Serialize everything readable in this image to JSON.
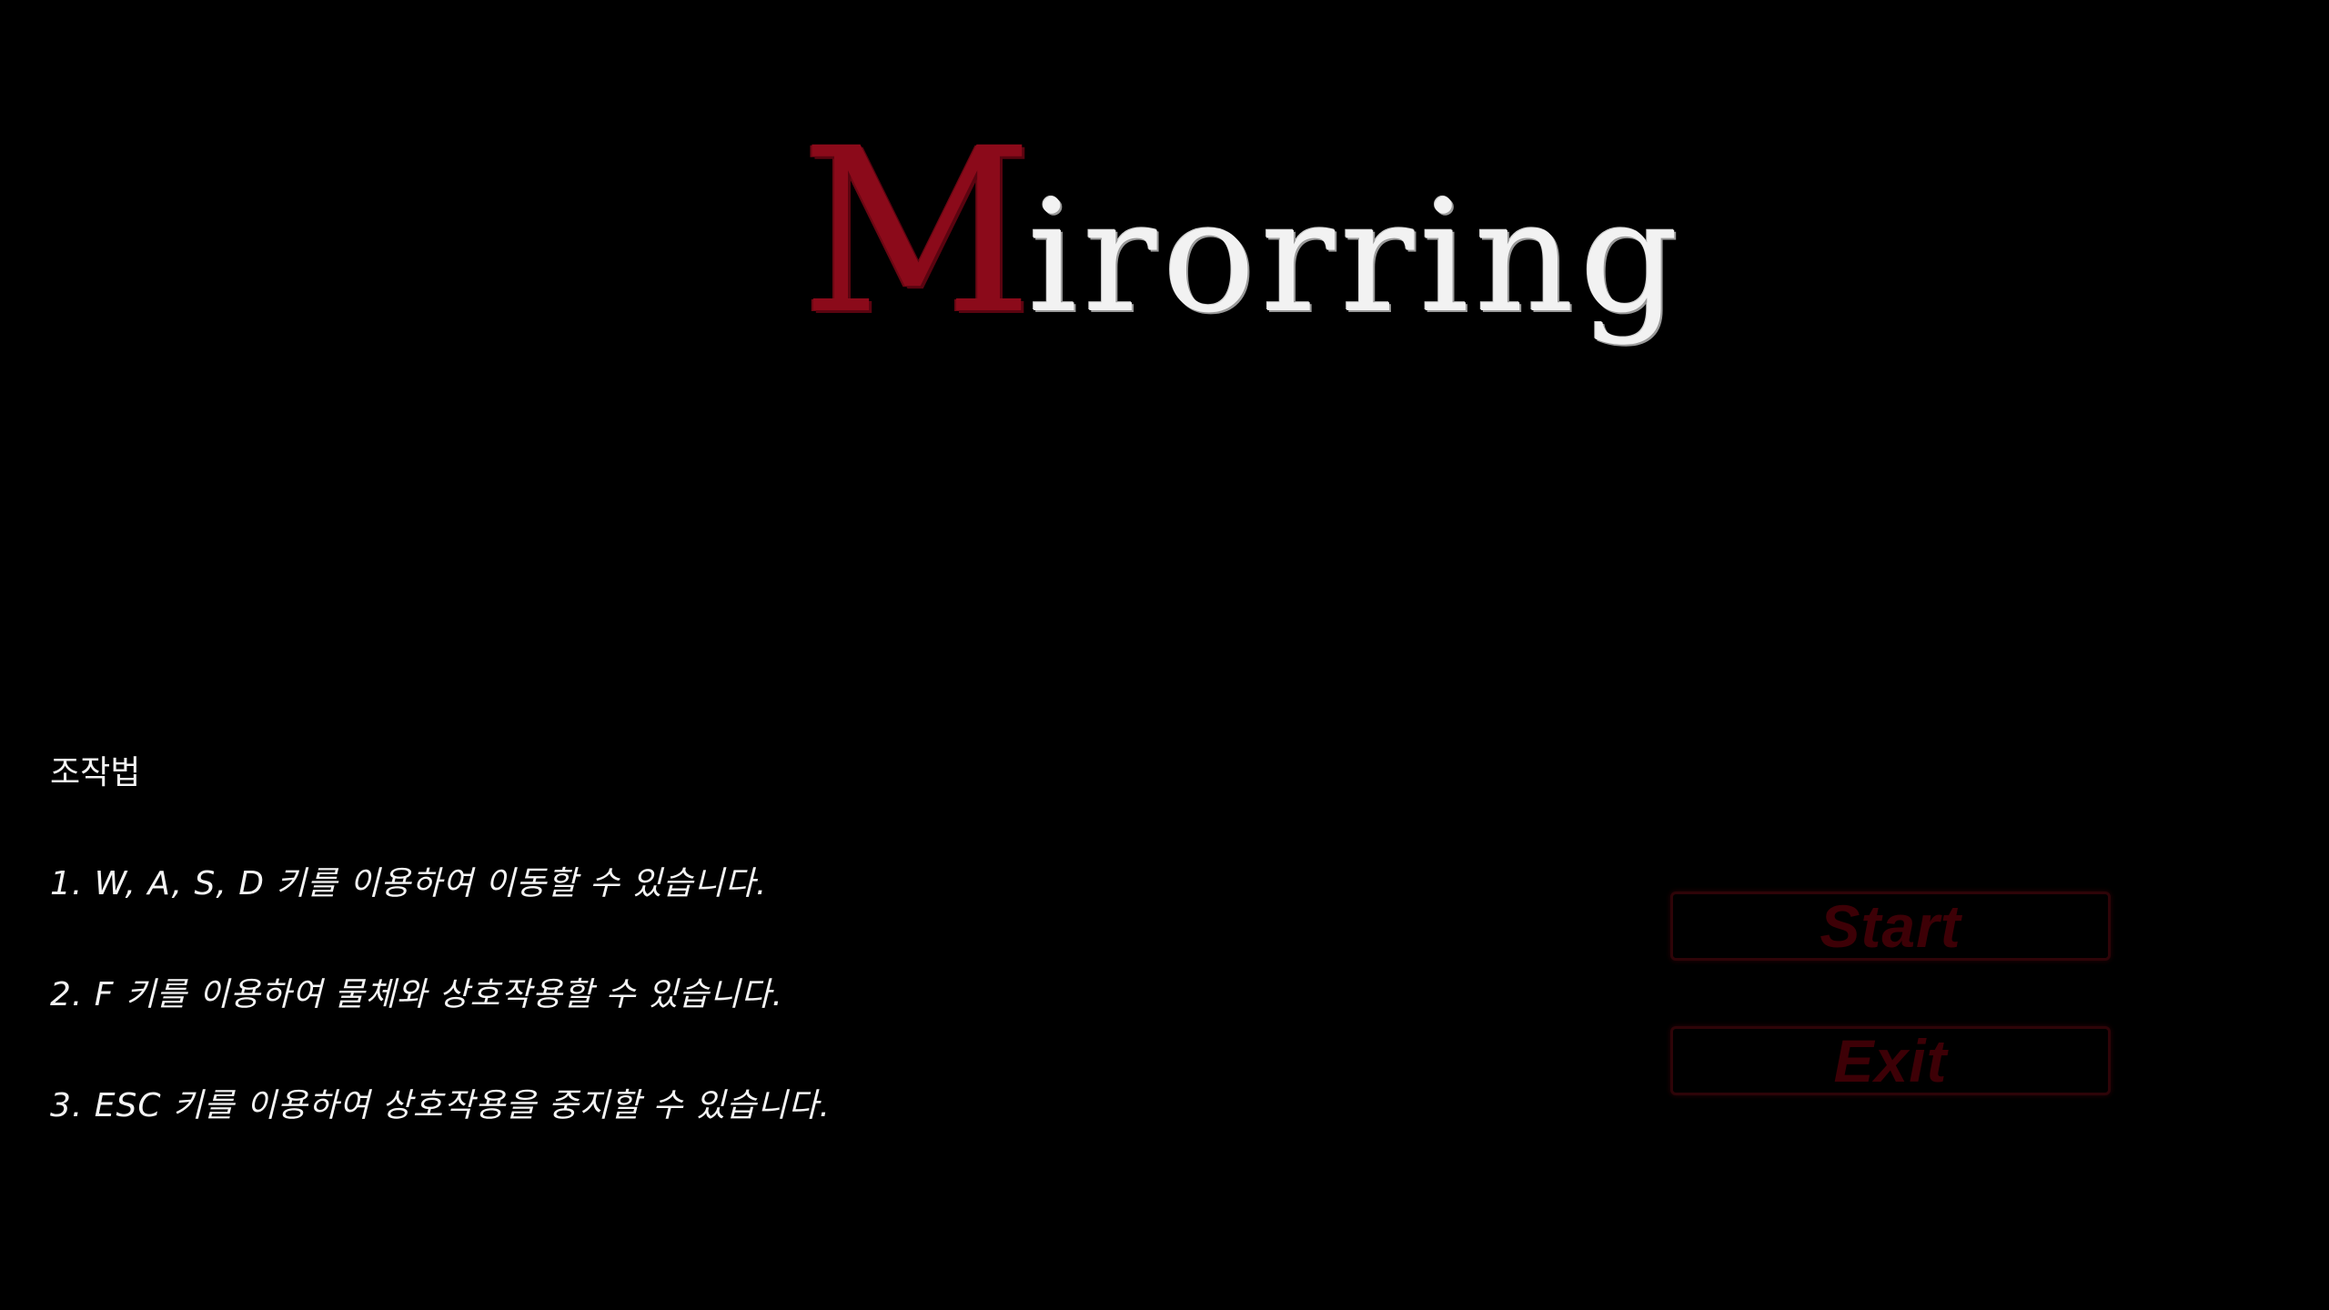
{
  "title": {
    "first_letter": "M",
    "rest": "irorring"
  },
  "colors": {
    "background": "#000000",
    "title_accent": "#8b0a1a",
    "title_main": "#f2f2f2",
    "text": "#f4f4f4",
    "button_text": "#3d0006",
    "button_border": "#2e0408"
  },
  "controls": {
    "heading": "조작법",
    "lines": [
      "1. W, A, S, D 키를 이용하여 이동할 수 있습니다.",
      "2. F 키를 이용하여 물체와 상호작용할 수 있습니다.",
      "3. ESC 키를 이용하여 상호작용을 중지할 수 있습니다."
    ]
  },
  "menu": {
    "start_label": "Start",
    "exit_label": "Exit"
  }
}
